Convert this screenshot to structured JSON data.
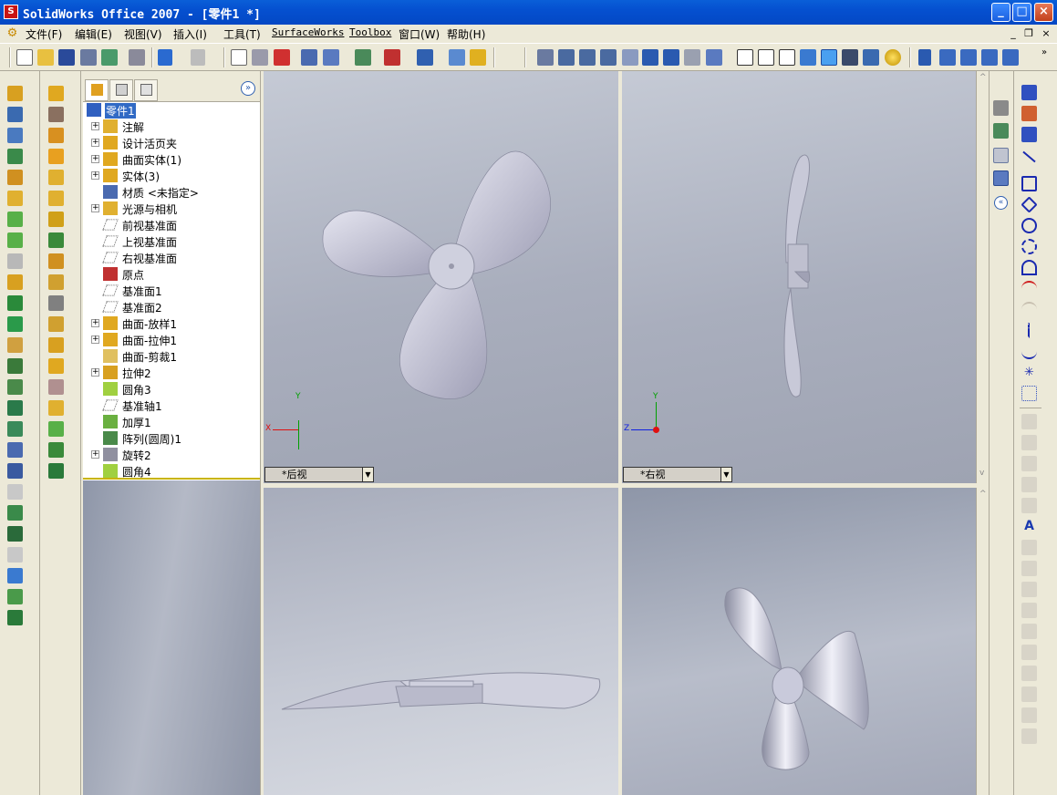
{
  "window": {
    "title": "SolidWorks Office 2007 - [零件1 *]",
    "app_icon_text": "S"
  },
  "menu": {
    "items": [
      "文件(F)",
      "编辑(E)",
      "视图(V)",
      "插入(I)",
      "工具(T)",
      "SurfaceWorks",
      "Toolbox",
      "窗口(W)",
      "帮助(H)"
    ]
  },
  "feature_tree": {
    "root": "零件1",
    "items": [
      {
        "label": "注解",
        "expandable": true,
        "icon": "annotation-icon"
      },
      {
        "label": "设计活页夹",
        "expandable": true,
        "icon": "design-binder-icon"
      },
      {
        "label": "曲面实体(1)",
        "expandable": true,
        "icon": "surface-bodies-icon"
      },
      {
        "label": "实体(3)",
        "expandable": true,
        "icon": "solid-bodies-icon"
      },
      {
        "label": "材质 <未指定>",
        "expandable": false,
        "icon": "material-icon"
      },
      {
        "label": "光源与相机",
        "expandable": true,
        "icon": "lights-cameras-icon"
      },
      {
        "label": "前视基准面",
        "expandable": false,
        "icon": "plane-icon"
      },
      {
        "label": "上视基准面",
        "expandable": false,
        "icon": "plane-icon"
      },
      {
        "label": "右视基准面",
        "expandable": false,
        "icon": "plane-icon"
      },
      {
        "label": "原点",
        "expandable": false,
        "icon": "origin-icon"
      },
      {
        "label": "基准面1",
        "expandable": false,
        "icon": "plane-icon"
      },
      {
        "label": "基准面2",
        "expandable": false,
        "icon": "plane-icon"
      },
      {
        "label": "曲面-放样1",
        "expandable": true,
        "icon": "surface-loft-icon"
      },
      {
        "label": "曲面-拉伸1",
        "expandable": true,
        "icon": "surface-extrude-icon"
      },
      {
        "label": "曲面-剪裁1",
        "expandable": false,
        "icon": "surface-trim-icon"
      },
      {
        "label": "拉伸2",
        "expandable": true,
        "icon": "extrude-icon"
      },
      {
        "label": "圆角3",
        "expandable": false,
        "icon": "fillet-icon"
      },
      {
        "label": "基准轴1",
        "expandable": false,
        "icon": "axis-icon"
      },
      {
        "label": "加厚1",
        "expandable": false,
        "icon": "thicken-icon"
      },
      {
        "label": "阵列(圆周)1",
        "expandable": false,
        "icon": "circular-pattern-icon"
      },
      {
        "label": "旋转2",
        "expandable": true,
        "icon": "revolve-icon"
      },
      {
        "label": "圆角4",
        "expandable": false,
        "icon": "fillet-icon"
      }
    ]
  },
  "viewports": {
    "back": {
      "label": "*后视",
      "axes": [
        "X",
        "Y"
      ]
    },
    "right": {
      "label": "*右视",
      "axes": [
        "Z",
        "Y"
      ]
    }
  },
  "glyphs": {
    "expand": "+",
    "minimize": "_",
    "maximize": "□",
    "close": "×",
    "dropdown": "▼",
    "collapse": "»",
    "collapse_left": "«",
    "scroll_up": "^",
    "scroll_down": "v",
    "mdi_min": "_",
    "mdi_restore": "❐",
    "mdi_close": "×"
  },
  "colors": {
    "titlebar": "#0550d0",
    "viewport_bg": "#a7acbb",
    "model": "#c8c9d8",
    "axis_x": "#e01010",
    "axis_y": "#00a000",
    "axis_z": "#1020e0",
    "rollback_bar": "#c8b400"
  }
}
